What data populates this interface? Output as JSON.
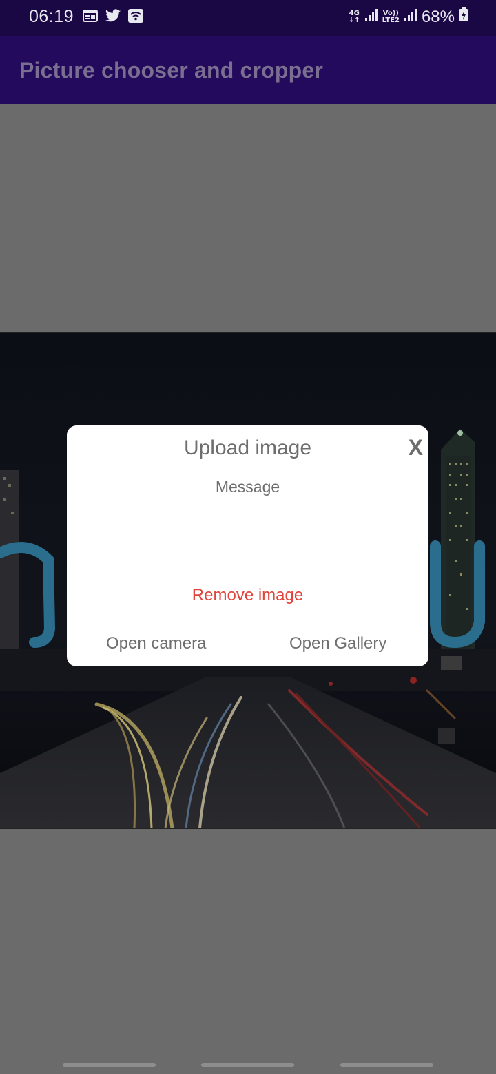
{
  "status_bar": {
    "time": "06:19",
    "network_top": "4G",
    "volte_top": "Vo))",
    "volte_bottom": "LTE2",
    "battery": "68%",
    "icons": [
      "calendar-icon",
      "twitter-icon",
      "wifi-icon",
      "signal-icon",
      "battery-icon"
    ]
  },
  "app_bar": {
    "title": "Picture chooser and cropper"
  },
  "dialog": {
    "title": "Upload image",
    "close_label": "X",
    "message": "Message",
    "remove_label": "Remove image",
    "camera_label": "Open camera",
    "gallery_label": "Open Gallery"
  },
  "colors": {
    "status_bar": "#1a0845",
    "app_bar": "#230a5c",
    "scrim": "#6b6b6b",
    "remove_accent": "#e0443a"
  }
}
